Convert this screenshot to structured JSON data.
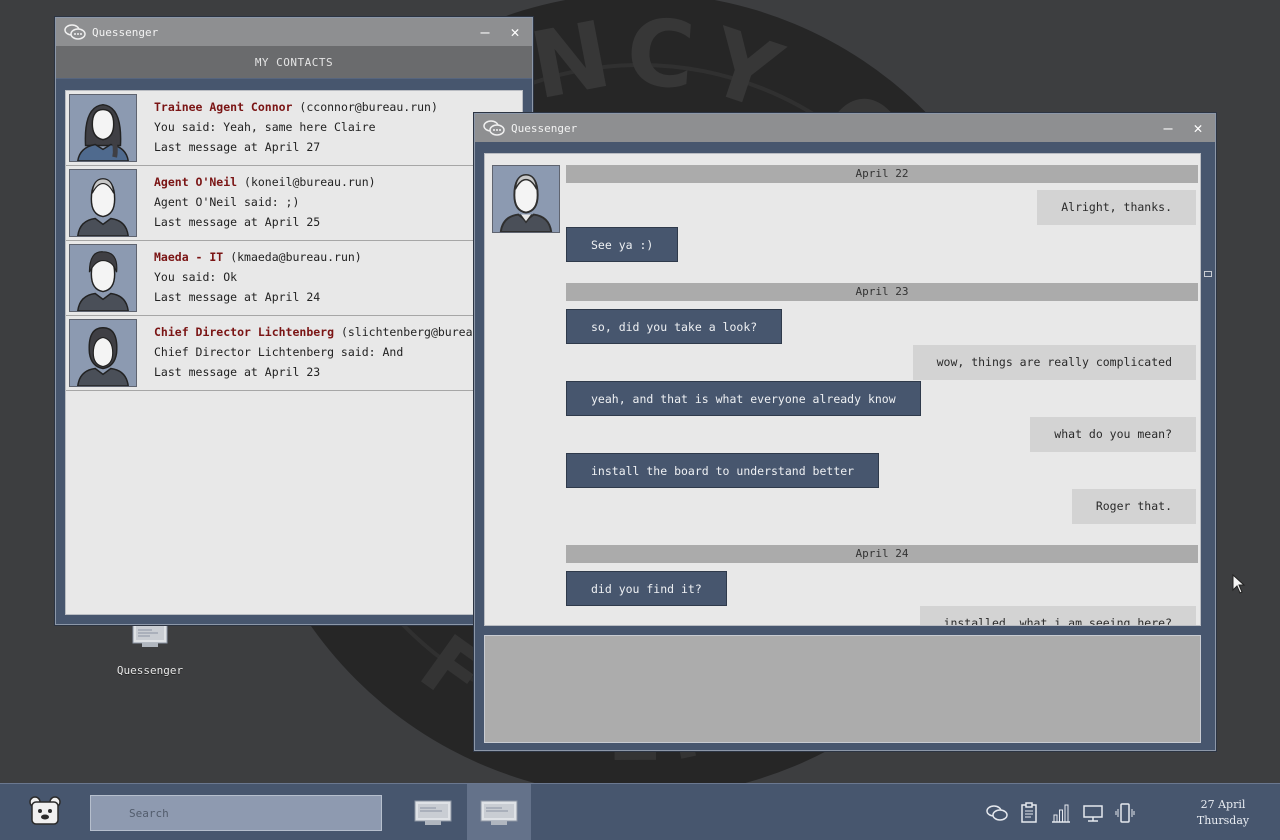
{
  "desktop": {
    "emblem_text": "AGENCY OF",
    "emblem_text_bottom": "FEDERAL",
    "icons": [
      {
        "label": "Quessenger",
        "icon": "monitor-icon"
      }
    ]
  },
  "contacts_window": {
    "title": "Quessenger",
    "header": "MY CONTACTS",
    "contacts": [
      {
        "name": "Trainee Agent Connor",
        "email": "(cconnor@bureau.run)",
        "preview": "You said: Yeah, same here Claire",
        "last": "Last message at April 27",
        "avatar": "female"
      },
      {
        "name": "Agent O'Neil",
        "email": "(koneil@bureau.run)",
        "preview": "Agent O'Neil said: ;)",
        "last": "Last message at April 25",
        "avatar": "bald"
      },
      {
        "name": "Maeda - IT",
        "email": "(kmaeda@bureau.run)",
        "preview": "You said: Ok",
        "last": "Last message at April 24",
        "avatar": "male"
      },
      {
        "name": "Chief Director Lichtenberg",
        "email": "(slichtenberg@bureau.run)",
        "preview": "Chief Director Lichtenberg said: And",
        "last": "Last message at April 23",
        "avatar": "hood"
      }
    ]
  },
  "chat_window": {
    "title": "Quessenger",
    "dates": [
      "April 22",
      "April 23",
      "April 24"
    ],
    "messages": [
      {
        "from": "them",
        "text": "Alright, thanks."
      },
      {
        "from": "me",
        "text": "See ya :)"
      },
      {
        "from": "me",
        "text": "so, did you take a look?"
      },
      {
        "from": "them",
        "text": "wow, things are really complicated"
      },
      {
        "from": "me",
        "text": "yeah, and that is what everyone already know"
      },
      {
        "from": "them",
        "text": "what do you mean?"
      },
      {
        "from": "me",
        "text": "install the board to understand better"
      },
      {
        "from": "them",
        "text": "Roger that."
      },
      {
        "from": "me",
        "text": "did you find it?"
      },
      {
        "from": "them",
        "text": "installed, what i am seeing here?"
      }
    ]
  },
  "taskbar": {
    "search_placeholder": "Search",
    "tray_icons": [
      "chat-icon",
      "clipboard-icon",
      "bar-chart-icon",
      "display-icon",
      "phone-vibrate-icon"
    ],
    "date": "27 April",
    "day": "Thursday"
  },
  "colors": {
    "window_frame": "#47566e",
    "titlebar": "#8e8f91",
    "contact_name": "#7a1414",
    "bubble_me": "#47566e",
    "bubble_them": "#d3d3d3"
  }
}
